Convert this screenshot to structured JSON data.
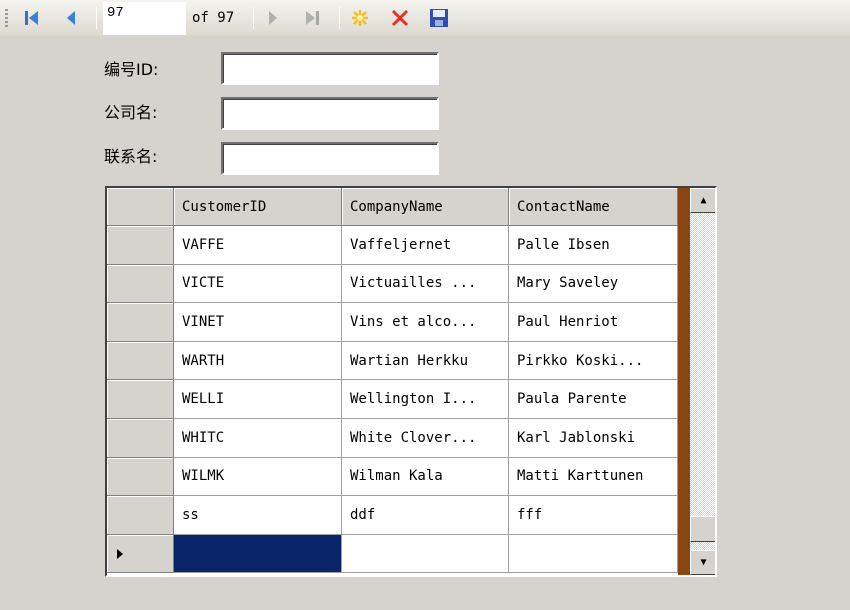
{
  "toolbar": {
    "position": "97",
    "of_label": "of 97",
    "icons": [
      "move-first-icon",
      "move-previous-icon",
      "move-next-icon",
      "move-last-icon",
      "add-new-icon",
      "delete-icon",
      "save-icon"
    ]
  },
  "form": {
    "id_label": "编号ID:",
    "company_label": "公司名:",
    "contact_label": "联系名:",
    "id_value": "",
    "company_value": "",
    "contact_value": ""
  },
  "grid": {
    "columns": [
      "CustomerID",
      "CompanyName",
      "ContactName"
    ],
    "rows": [
      [
        "VAFFE",
        "Vaffeljernet",
        "Palle Ibsen"
      ],
      [
        "VICTE",
        "Victuailles ...",
        "Mary Saveley"
      ],
      [
        "VINET",
        "Vins et alco...",
        "Paul Henriot"
      ],
      [
        "WARTH",
        "Wartian Herkku",
        "Pirkko Koski..."
      ],
      [
        "WELLI",
        "Wellington I...",
        "Paula Parente"
      ],
      [
        "WHITC",
        "White Clover...",
        "Karl Jablonski"
      ],
      [
        "WILMK",
        "Wilman Kala",
        "Matti Karttunen"
      ],
      [
        "ss",
        "ddf",
        "fff"
      ],
      [
        "",
        "",
        ""
      ]
    ],
    "selection_color": "#0a246a"
  }
}
